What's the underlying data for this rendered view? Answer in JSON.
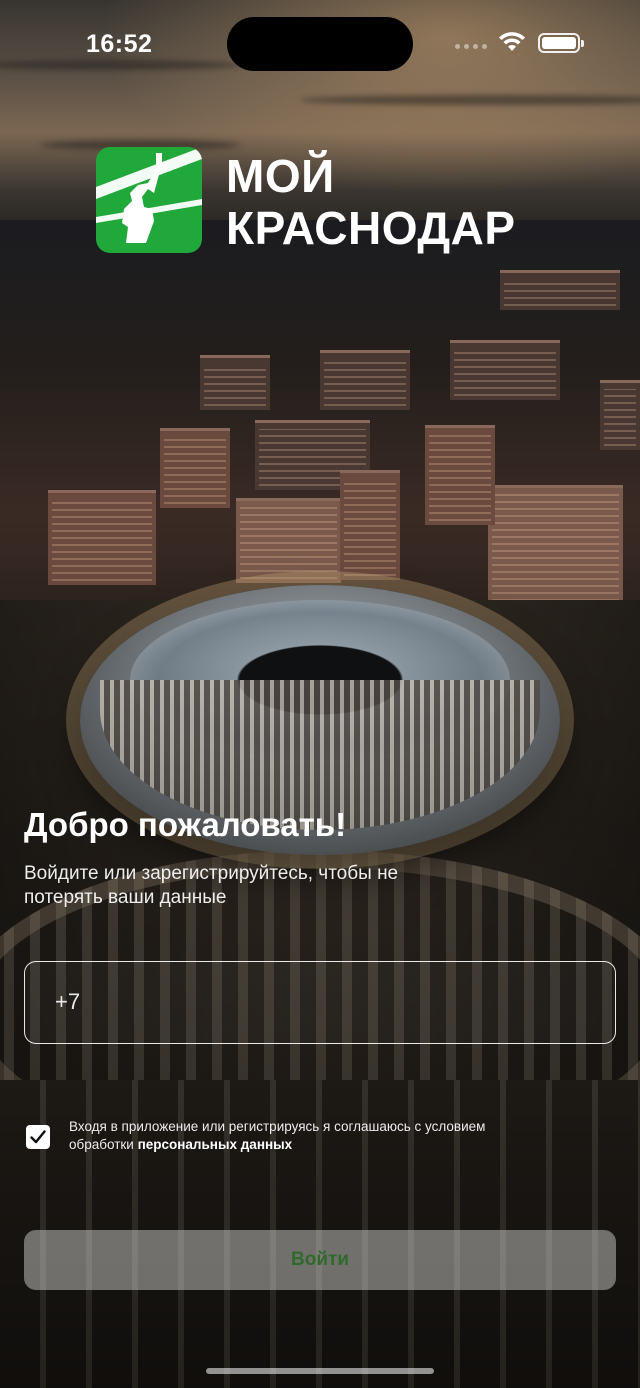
{
  "status_bar": {
    "time": "16:52"
  },
  "brand": {
    "line1": "МОЙ",
    "line2": "КРАСНОДАР",
    "logo_color": "#21a83a"
  },
  "login": {
    "title": "Добро пожаловать!",
    "subtitle": "Войдите или зарегистрируйтесь, чтобы не потерять ваши данные",
    "phone_placeholder": "+7",
    "consent_text": "Входя в приложение или регистрируясь я соглашаюсь с условием обработки ",
    "consent_link": "персональных данных",
    "consent_checked": true,
    "submit_label": "Войти"
  },
  "icons": [
    "logo-icon",
    "wifi-icon",
    "battery-icon",
    "cellular-icon",
    "checkmark-icon"
  ]
}
